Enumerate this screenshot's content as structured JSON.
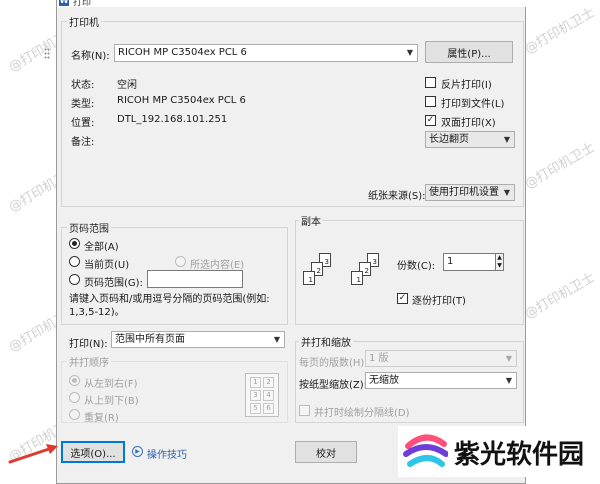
{
  "window": {
    "title": "打印"
  },
  "printer": {
    "group_label": "打印机",
    "name_label": "名称(N):",
    "name_value": "RICOH MP C3504ex PCL 6",
    "properties_button": "属性(P)...",
    "status_label": "状态:",
    "status_value": "空闲",
    "type_label": "类型:",
    "type_value": "RICOH MP C3504ex PCL 6",
    "location_label": "位置:",
    "location_value": "DTL_192.168.101.251",
    "comment_label": "备注:",
    "reverse_print": "反片打印(I)",
    "print_to_file": "打印到文件(L)",
    "duplex_print": "双面打印(X)",
    "duplex_mode": "长边翻页",
    "paper_source_label": "纸张来源(S):",
    "paper_source_value": "使用打印机设置"
  },
  "page_range": {
    "group_label": "页码范围",
    "all": "全部(A)",
    "current_page": "当前页(U)",
    "selection": "所选内容(E)",
    "pages": "页码范围(G):",
    "hint": "请键入页码和/或用逗号分隔的页码范围(例如: 1,3,5-12)。"
  },
  "copies": {
    "group_label": "副本",
    "count_label": "份数(C):",
    "count_value": "1",
    "collate": "逐份打印(T)",
    "icon_pages": [
      "1",
      "2",
      "3"
    ]
  },
  "print_what": {
    "label": "打印(N):",
    "value": "范围中所有页面",
    "order_label": "并打顺序",
    "left_to_right": "从左到右(F)",
    "top_to_bottom": "从上到下(B)",
    "repeat": "重复(R)",
    "grid": [
      "1",
      "2",
      "3",
      "4",
      "5",
      "6"
    ]
  },
  "zoom": {
    "group_label": "并打和缩放",
    "pages_per_sheet_label": "每页的版数(H):",
    "pages_per_sheet_value": "1 版",
    "scale_label": "按纸型缩放(Z):",
    "scale_value": "无缩放",
    "draw_borders": "并打时绘制分隔线(D)"
  },
  "footer": {
    "options_button": "选项(O)...",
    "tips_link": "操作技巧",
    "ok_button": "校对"
  },
  "watermark": "@打印机卫士",
  "brand": {
    "name": "紫光软件园"
  },
  "colors": {
    "accent": "#0078d7",
    "brand_purple": "#6d3fd6",
    "annotation_arrow": "#e03a2e"
  }
}
